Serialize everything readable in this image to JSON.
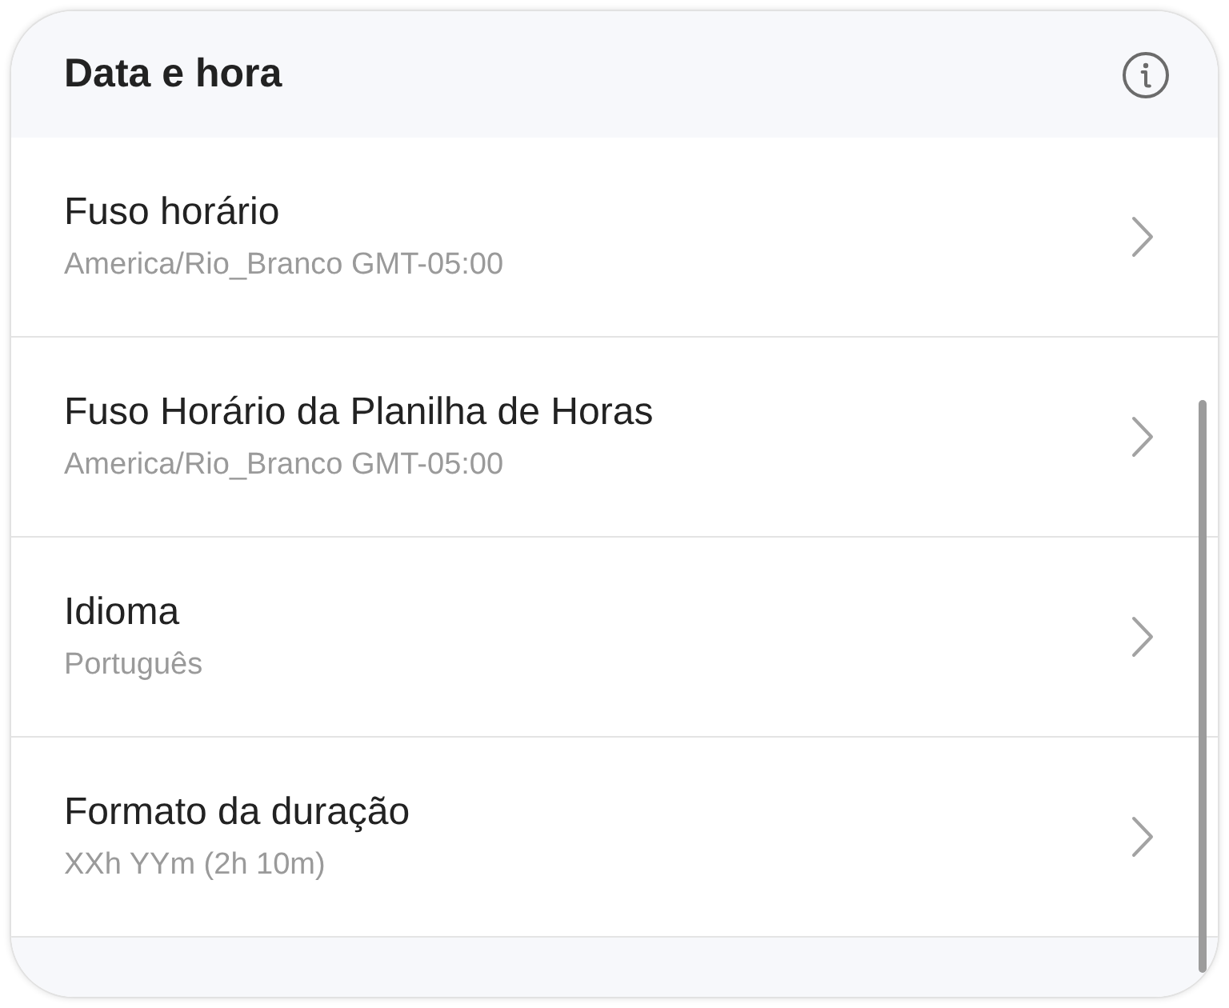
{
  "header": {
    "title": "Data e hora"
  },
  "items": [
    {
      "label": "Fuso horário",
      "value": "America/Rio_Branco GMT-05:00"
    },
    {
      "label": "Fuso Horário da Planilha de Horas",
      "value": "America/Rio_Branco GMT-05:00"
    },
    {
      "label": "Idioma",
      "value": "Português"
    },
    {
      "label": "Formato da duração",
      "value": "XXh YYm (2h 10m)"
    }
  ]
}
